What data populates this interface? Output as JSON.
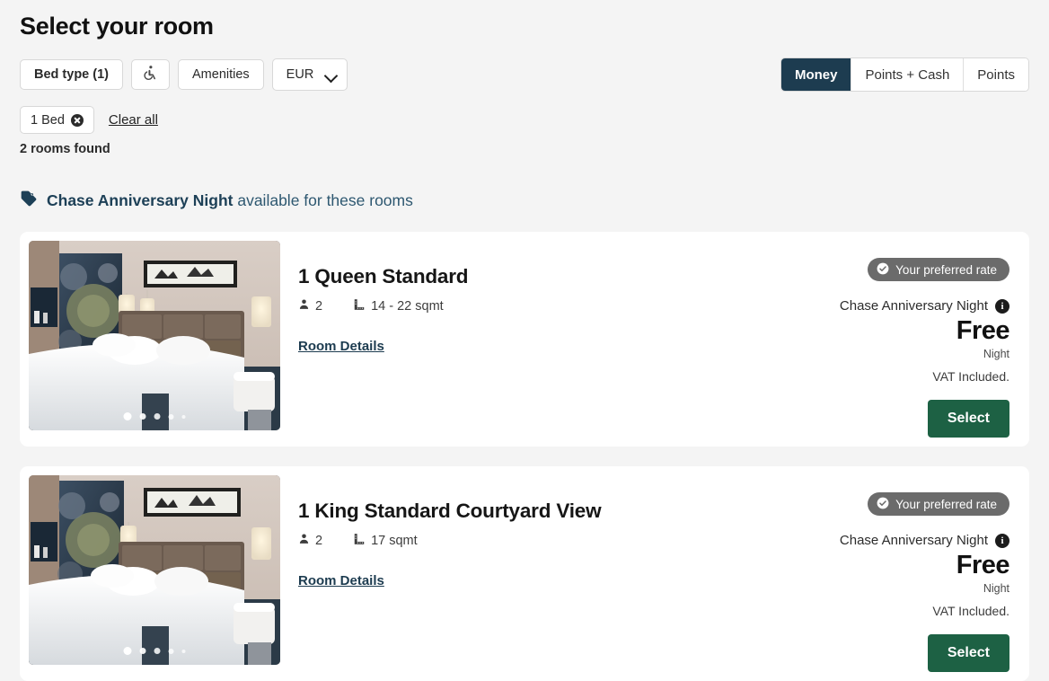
{
  "header": {
    "title": "Select your room"
  },
  "filters": {
    "bed_type": "Bed type (1)",
    "accessibility_icon": "wheelchair-accessibility-icon",
    "amenities": "Amenities",
    "currency": "EUR",
    "currency_chevron_icon": "chevron-down-icon"
  },
  "rate_toggle": {
    "options": [
      "Money",
      "Points + Cash",
      "Points"
    ],
    "selected": "Money",
    "active_color": "#1d3c50"
  },
  "applied_filters": {
    "chips": [
      {
        "label": "1 Bed",
        "remove_icon": "close-circle-icon"
      }
    ],
    "clear_all": "Clear all",
    "results_count": "2 rooms found"
  },
  "promo": {
    "tag_icon": "price-tag-icon",
    "highlight": "Chase Anniversary Night",
    "text": " available for these rooms",
    "color": "#1d4057"
  },
  "rooms": [
    {
      "name": "1 Queen Standard",
      "occupancy_icon": "person-icon",
      "occupancy": "2",
      "size_icon": "ruler-icon",
      "size": "14 - 22 sqmt",
      "details_link": "Room Details",
      "carousel": {
        "total_dots": 5,
        "active_index": 0
      },
      "rate": {
        "preferred_badge": "Your preferred rate",
        "preferred_badge_icon": "check-circle-icon",
        "rate_name": "Chase Anniversary Night",
        "info_icon": "info-icon",
        "price": "Free",
        "per": "Night",
        "tax_note": "VAT Included.",
        "select_label": "Select",
        "select_color": "#1d6144"
      }
    },
    {
      "name": "1 King Standard Courtyard View",
      "occupancy_icon": "person-icon",
      "occupancy": "2",
      "size_icon": "ruler-icon",
      "size": "17 sqmt",
      "details_link": "Room Details",
      "carousel": {
        "total_dots": 5,
        "active_index": 0
      },
      "rate": {
        "preferred_badge": "Your preferred rate",
        "preferred_badge_icon": "check-circle-icon",
        "rate_name": "Chase Anniversary Night",
        "info_icon": "info-icon",
        "price": "Free",
        "per": "Night",
        "tax_note": "VAT Included.",
        "select_label": "Select",
        "select_color": "#1d6144"
      }
    }
  ]
}
